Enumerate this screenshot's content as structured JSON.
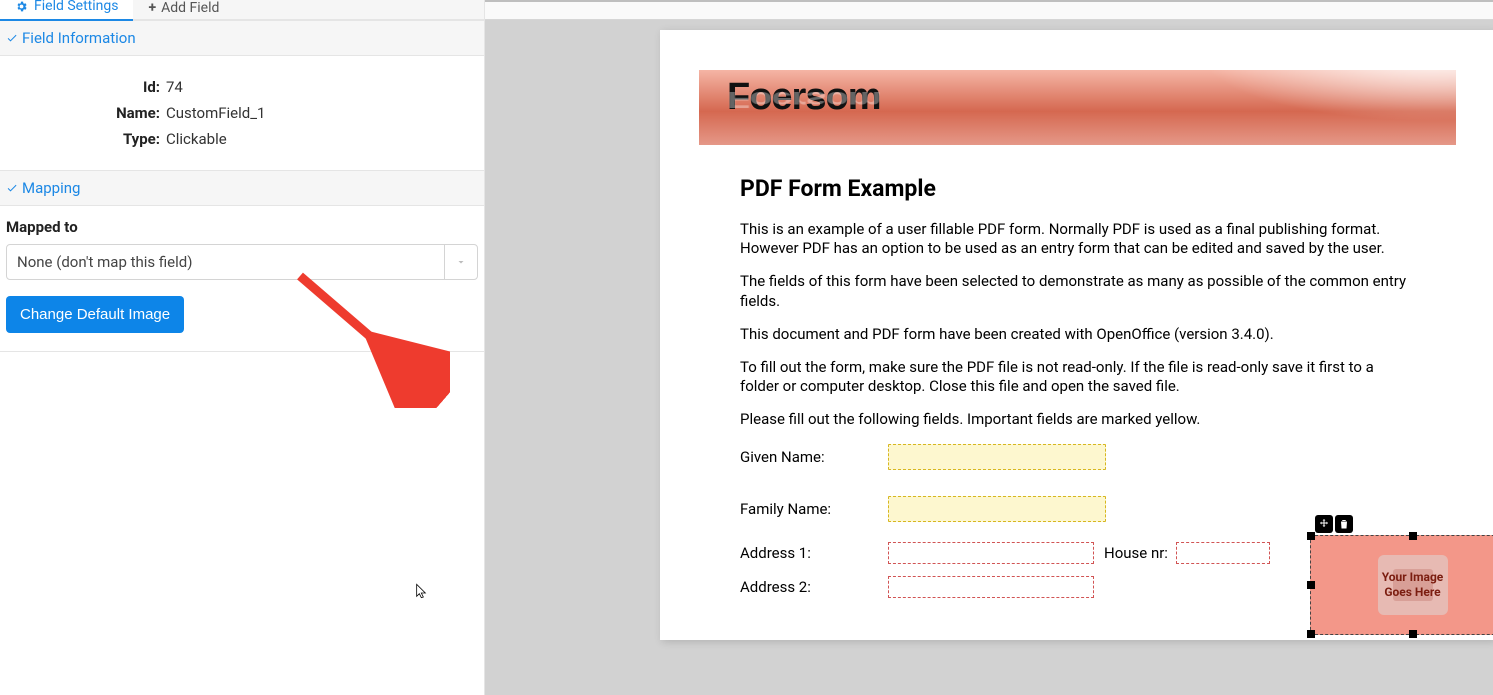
{
  "tabs": {
    "field_settings": "Field Settings",
    "add_field": "Add Field"
  },
  "sections": {
    "field_info_title": "Field Information",
    "mapping_title": "Mapping"
  },
  "field_info": {
    "id_label": "Id:",
    "id_value": "74",
    "name_label": "Name:",
    "name_value": "CustomField_1",
    "type_label": "Type:",
    "type_value": "Clickable"
  },
  "mapping": {
    "label": "Mapped to",
    "selected": "None (don't map this field)",
    "button": "Change Default Image"
  },
  "doc": {
    "brand": "Foersom",
    "title": "PDF Form Example",
    "p1": "This is an example of a user fillable PDF form. Normally PDF is used as a final publishing format. However PDF has an option to be used as an entry form that can be edited and saved by the user.",
    "p2": "The fields of this form have been selected to demonstrate as many as possible of the common entry fields.",
    "p3": "This document and PDF form have been created with OpenOffice (version 3.4.0).",
    "p4": "To fill out the form, make sure the PDF file is not read-only. If the file is read-only save it first to a folder or computer desktop. Close this file and open the saved file.",
    "p5": "Please fill out the following fields. Important fields are marked yellow.",
    "given_name": "Given Name:",
    "family_name": "Family Name:",
    "address1": "Address 1:",
    "address2": "Address 2:",
    "house_nr": "House nr:",
    "image_ph_line1": "Your Image",
    "image_ph_line2": "Goes Here"
  }
}
